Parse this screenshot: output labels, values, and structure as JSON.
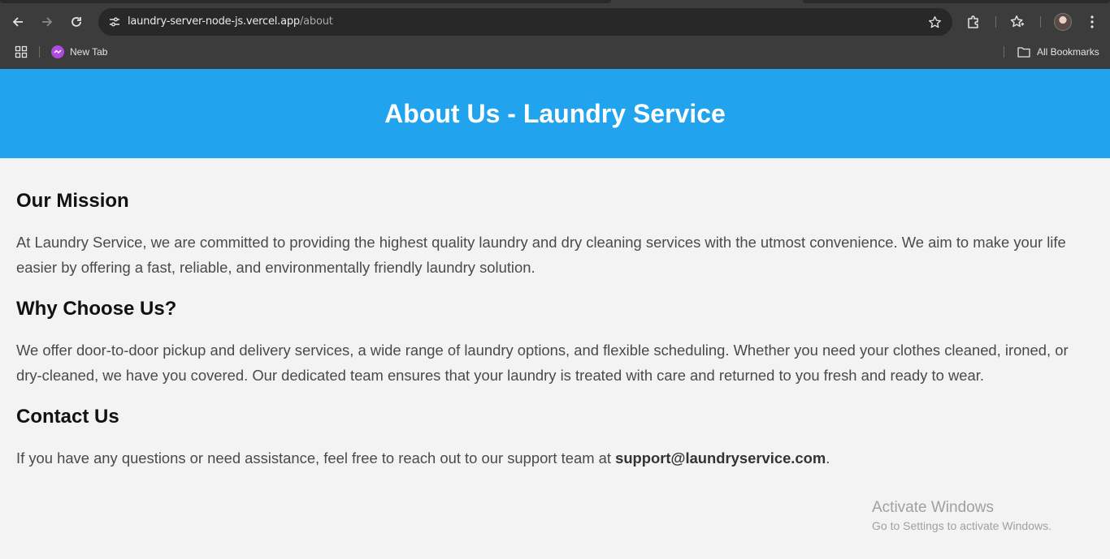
{
  "browser": {
    "url_host": "laundry-server-node-js.vercel.app",
    "url_path": "/about",
    "bookmarks": {
      "new_tab_label": "New Tab",
      "all_bookmarks_label": "All Bookmarks"
    },
    "icons": [
      "back-arrow-icon",
      "forward-arrow-icon",
      "reload-icon",
      "site-info-icon",
      "star-icon",
      "extensions-icon",
      "bookmarks-star-icon",
      "profile-avatar",
      "more-vert-icon",
      "apps-grid-icon",
      "folder-icon"
    ]
  },
  "page": {
    "title": "About Us - Laundry Service",
    "header_color": "#22a3ee",
    "sections": [
      {
        "heading": "Our Mission",
        "text": "At Laundry Service, we are committed to providing the highest quality laundry and dry cleaning services with the utmost convenience. We aim to make your life easier by offering a fast, reliable, and environmentally friendly laundry solution."
      },
      {
        "heading": "Why Choose Us?",
        "text": "We offer door-to-door pickup and delivery services, a wide range of laundry options, and flexible scheduling. Whether you need your clothes cleaned, ironed, or dry-cleaned, we have you covered. Our dedicated team ensures that your laundry is treated with care and returned to you fresh and ready to wear."
      },
      {
        "heading": "Contact Us",
        "text_before": "If you have any questions or need assistance, feel free to reach out to our support team at ",
        "email": "support@laundryservice.com",
        "text_after": "."
      }
    ]
  },
  "watermark": {
    "title": "Activate Windows",
    "subtitle": "Go to Settings to activate Windows."
  }
}
